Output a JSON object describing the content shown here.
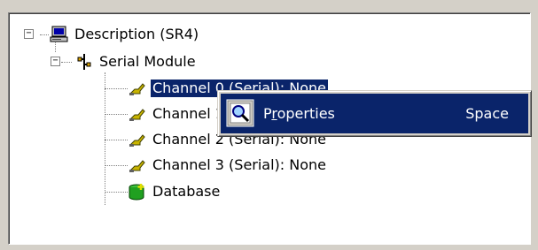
{
  "tree": {
    "root": {
      "label": "Description (SR4)",
      "icon": "computer-icon",
      "expanded": true
    },
    "module": {
      "label": "Serial Module",
      "icon": "serial-connector-icon",
      "expanded": true
    },
    "channels": [
      {
        "label": "Channel 0 (Serial): None",
        "icon": "serial-plug-icon",
        "selected": true
      },
      {
        "label": "Channel 1 (Serial): None",
        "icon": "serial-plug-icon",
        "selected": false
      },
      {
        "label": "Channel 2 (Serial): None",
        "icon": "serial-plug-icon",
        "selected": false
      },
      {
        "label": "Channel 3 (Serial): None",
        "icon": "serial-plug-icon",
        "selected": false
      }
    ],
    "database": {
      "label": "Database",
      "icon": "database-add-icon"
    }
  },
  "context_menu": {
    "items": [
      {
        "label": "Properties",
        "mnemonic": "r",
        "shortcut": "Space",
        "icon": "magnifier-icon",
        "highlighted": true
      }
    ]
  },
  "colors": {
    "selection": "#0a246a",
    "window_bg": "#d4d0c8"
  }
}
